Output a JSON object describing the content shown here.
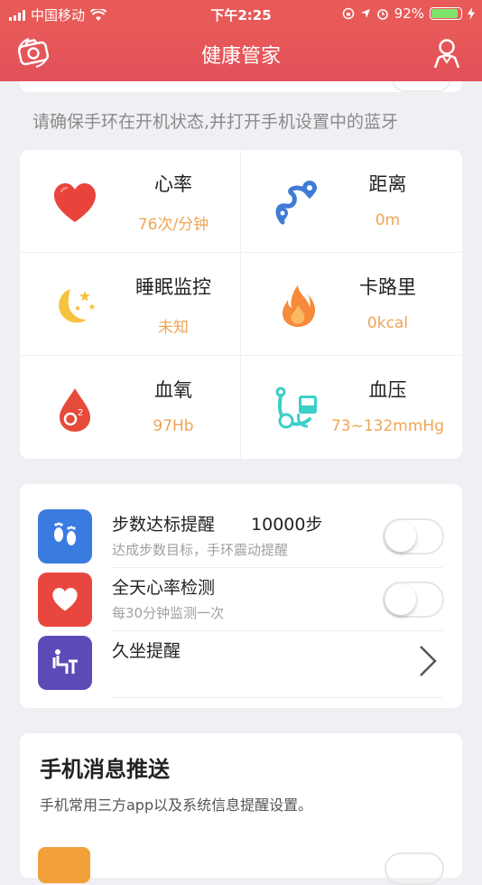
{
  "status_bar": {
    "carrier": "中国移动",
    "time": "下午2:25",
    "battery": "92%",
    "battery_level": 0.92,
    "icons": [
      "signal-icon",
      "wifi-icon",
      "orientation-lock-icon",
      "location-icon",
      "alarm-icon",
      "battery-icon",
      "charging-icon"
    ]
  },
  "nav": {
    "title": "健康管家",
    "left_icon": "camera-icon",
    "right_icon": "user-icon"
  },
  "hint": "请确保手环在开机状态,并打开手机设置中的蓝牙",
  "metrics": [
    {
      "label": "心率",
      "value": "76次/分钟",
      "icon": "heart-icon"
    },
    {
      "label": "距离",
      "value": "0m",
      "icon": "route-pin-icon"
    },
    {
      "label": "睡眠监控",
      "value": "未知",
      "icon": "moon-stars-icon"
    },
    {
      "label": "卡路里",
      "value": "0kcal",
      "icon": "flame-icon"
    },
    {
      "label": "血氧",
      "value": "97Hb",
      "icon": "blood-drop-o2-icon"
    },
    {
      "label": "血压",
      "value": "73~132mmHg",
      "icon": "stethoscope-icon"
    }
  ],
  "settings": [
    {
      "title": "步数达标提醒",
      "extra": "10000步",
      "subtitle": "达成步数目标，手环震动提醒",
      "icon": "footprints-icon",
      "color": "#3a7be0",
      "control": "toggle",
      "on": false
    },
    {
      "title": "全天心率检测",
      "extra": "",
      "subtitle": "每30分钟监测一次",
      "icon": "heart-icon",
      "color": "#e8473f",
      "control": "toggle",
      "on": false
    },
    {
      "title": "久坐提醒",
      "extra": "",
      "subtitle": "",
      "icon": "sitting-icon",
      "color": "#5b4bb7",
      "control": "chevron"
    }
  ],
  "push": {
    "title": "手机消息推送",
    "description": "手机常用三方app以及系统信息提醒设置。"
  },
  "colors": {
    "header": "#e85a58",
    "value_text": "#f0a555",
    "background": "#f0f0f4"
  }
}
